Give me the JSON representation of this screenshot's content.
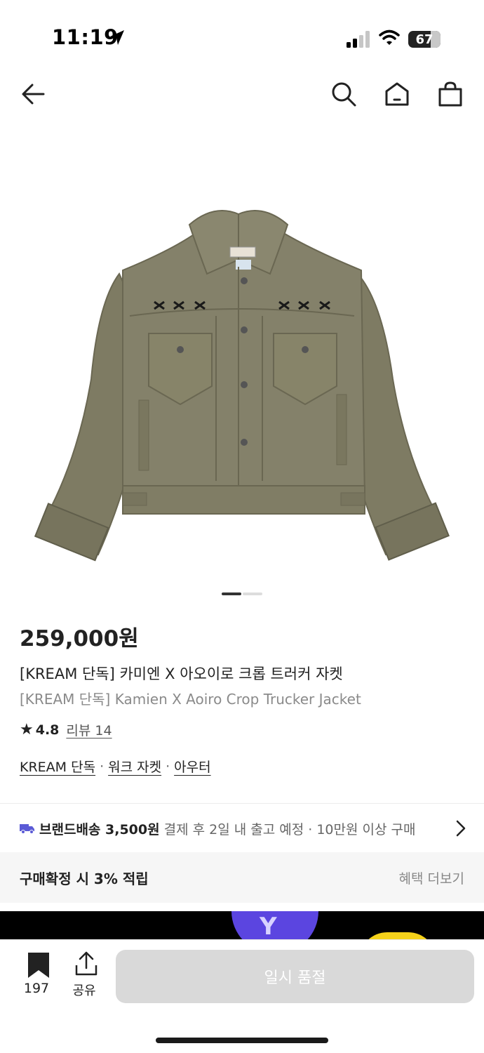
{
  "status_bar": {
    "time": "11:19",
    "battery": "67",
    "icons": [
      "location-arrow-icon",
      "signal-icon",
      "wifi-icon",
      "battery-icon"
    ]
  },
  "nav": {
    "icons": [
      "back-arrow-icon",
      "search-icon",
      "home-icon",
      "shopping-bag-icon"
    ]
  },
  "gallery": {
    "image": "olive-trucker-jacket",
    "active_index": 1,
    "total": 2
  },
  "product": {
    "price": "259,000원",
    "title_ko": "[KREAM 단독] 카미엔 X 아오이로 크롭 트러커 자켓",
    "title_en": "[KREAM 단독] Kamien X Aoiro Crop Trucker Jacket",
    "rating": "4.8",
    "review_label": "리뷰 14",
    "tags": [
      "KREAM 단독",
      "워크 자켓",
      "아우터"
    ],
    "tag_separator": "·"
  },
  "shipping": {
    "label": "브랜드배송 3,500원",
    "desc": "결제 후 2일 내 출고 예정 · 10만원 이상 구매",
    "icon": "truck-icon"
  },
  "benefit": {
    "text": "구매확정 시 3% 적립",
    "more": "혜택 더보기"
  },
  "banner": {
    "letter": "Y"
  },
  "bottom_bar": {
    "bookmark_count": "197",
    "share_label": "공유",
    "cta_label": "일시 품절"
  },
  "colors": {
    "accent_truck": "#5b5bd6",
    "cta_disabled": "#d9d9d9",
    "jacket": "#807d65"
  }
}
